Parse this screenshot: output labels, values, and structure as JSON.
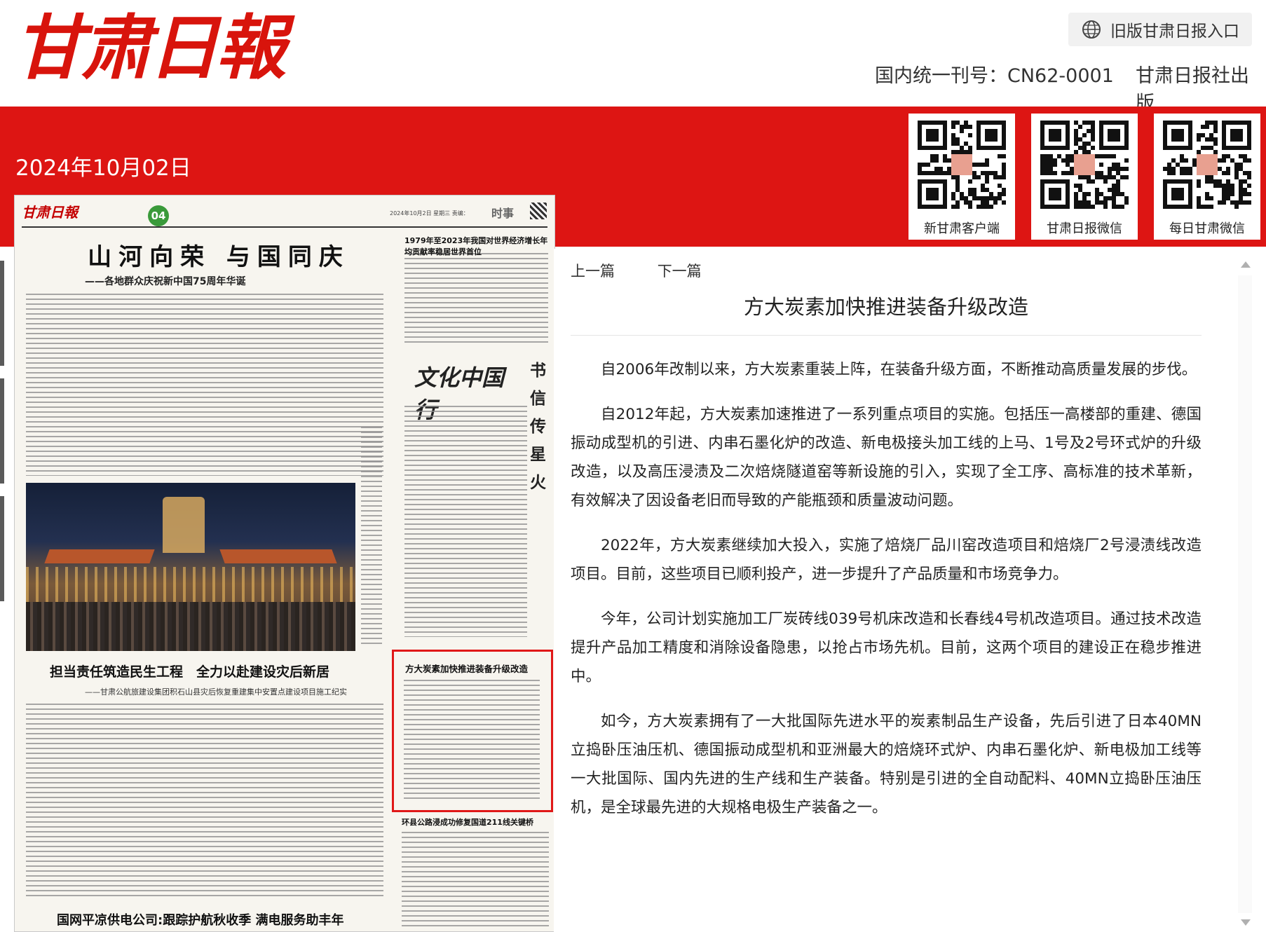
{
  "header": {
    "logo": "甘肃日報",
    "old_entry_label": "旧版甘肃日报入口",
    "issn": "国内统一刊号：CN62-0001",
    "publisher": "甘肃日报社出版"
  },
  "date": "2024年10月02日",
  "qr_codes": [
    {
      "label": "新甘肃客户端"
    },
    {
      "label": "甘肃日报微信"
    },
    {
      "label": "每日甘肃微信"
    }
  ],
  "paper": {
    "masthead": "甘肃日報",
    "page_number": "04",
    "column": "时事",
    "date_line": "2024年10月2日 星期三 责编：",
    "headline1": "山河向荣 与国同庆",
    "sub1": "——各地群众庆祝新中国75周年华诞",
    "right_headline1": "1979年至2023年我国对世界经济增长年均贡献率稳居世界首位",
    "brand_title": "文化中国行",
    "vertical_title": "书信传星火",
    "headline2": "担当责任筑造民生工程　全力以赴建设灾后新居",
    "sub2": "——甘肃公航旅建设集团积石山县灾后恢复重建集中安置点建设项目施工纪实",
    "highlight_title": "方大炭素加快推进装备升级改造",
    "right_headline2": "环县公路浸成功修复国道211线关键桥",
    "headline3": "国网平凉供电公司:跟踪护航秋收季 满电服务助丰年"
  },
  "article": {
    "prev": "上一篇",
    "next": "下一篇",
    "title": "方大炭素加快推进装备升级改造",
    "paragraphs": [
      "自2006年改制以来，方大炭素重装上阵，在装备升级方面，不断推动高质量发展的步伐。",
      "自2012年起，方大炭素加速推进了一系列重点项目的实施。包括压一高楼部的重建、德国振动成型机的引进、内串石墨化炉的改造、新电极接头加工线的上马、1号及2号环式炉的升级改造，以及高压浸渍及二次焙烧隧道窑等新设施的引入，实现了全工序、高标准的技术革新，有效解决了因设备老旧而导致的产能瓶颈和质量波动问题。",
      "2022年，方大炭素继续加大投入，实施了焙烧厂品川窑改造项目和焙烧厂2号浸渍线改造项目。目前，这些项目已顺利投产，进一步提升了产品质量和市场竞争力。",
      "今年，公司计划实施加工厂炭砖线039号机床改造和长春线4号机改造项目。通过技术改造提升产品加工精度和消除设备隐患，以抢占市场先机。目前，这两个项目的建设正在稳步推进中。",
      "如今，方大炭素拥有了一大批国际先进水平的炭素制品生产设备，先后引进了日本40MN立捣卧压油压机、德国振动成型机和亚洲最大的焙烧环式炉、内串石墨化炉、新电极加工线等一大批国际、国内先进的生产线和生产装备。特别是引进的全自动配料、40MN立捣卧压油压机，是全球最先进的大规格电极生产装备之一。"
    ]
  },
  "colors": {
    "brand_red": "#dd1513",
    "logo_red": "#d8140c",
    "highlight_border": "#e01818"
  }
}
